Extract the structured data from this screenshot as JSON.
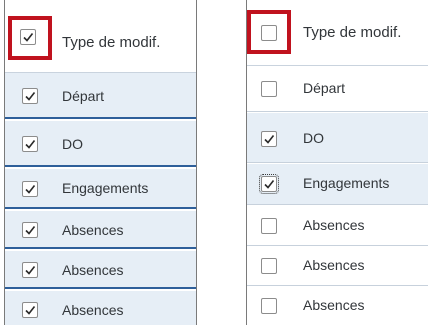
{
  "colors": {
    "highlight": "#c0121e",
    "checked_row_bg": "#e6eef6",
    "row_border_selected": "#2e5f9a",
    "text": "#32363a"
  },
  "left_table": {
    "header": {
      "label": "Type de modif.",
      "checked": true
    },
    "rows": [
      {
        "label": "Départ",
        "checked": true
      },
      {
        "label": "DO",
        "checked": true
      },
      {
        "label": "Engagements",
        "checked": true
      },
      {
        "label": "Absences",
        "checked": true
      },
      {
        "label": "Absences",
        "checked": true
      },
      {
        "label": "Absences",
        "checked": true
      }
    ]
  },
  "right_table": {
    "header": {
      "label": "Type de modif.",
      "checked": false
    },
    "rows": [
      {
        "label": "Départ",
        "checked": false
      },
      {
        "label": "DO",
        "checked": true
      },
      {
        "label": "Engagements",
        "checked": true
      },
      {
        "label": "Absences",
        "checked": false
      },
      {
        "label": "Absences",
        "checked": false
      },
      {
        "label": "Absences",
        "checked": false
      }
    ]
  },
  "checkmark_icon": "check-icon"
}
